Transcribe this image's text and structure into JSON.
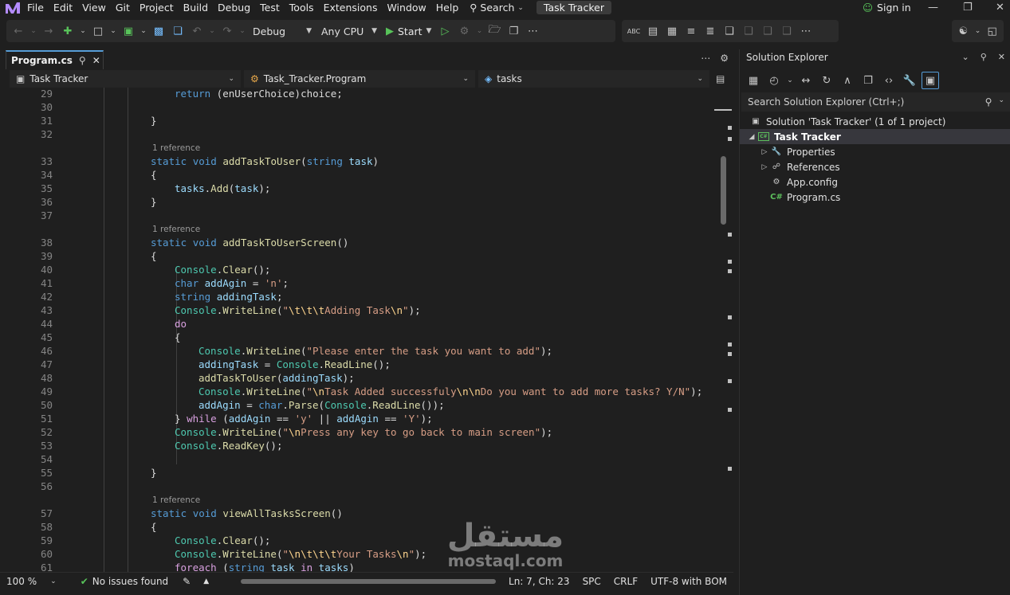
{
  "menu": {
    "items": [
      "File",
      "Edit",
      "View",
      "Git",
      "Project",
      "Build",
      "Debug",
      "Test",
      "Tools",
      "Extensions",
      "Window",
      "Help"
    ],
    "search_label": "Search",
    "window_title": "Task Tracker",
    "sign_in": "Sign in"
  },
  "toolbar": {
    "config": "Debug",
    "platform": "Any CPU",
    "start": "Start"
  },
  "editor": {
    "tab_label": "Program.cs",
    "nav_project": "Task Tracker",
    "nav_class": "Task_Tracker.Program",
    "nav_member": "tasks",
    "codelens": "1 reference",
    "lines": [
      {
        "n": "29",
        "tokens": [
          [
            "kw",
            "return"
          ],
          [
            "pl",
            " ("
          ],
          [
            "pl",
            "enUserChoice"
          ],
          [
            "pl",
            ")"
          ],
          [
            "pl",
            "choice;"
          ]
        ],
        "indent": 1
      },
      {
        "n": "30",
        "tokens": [],
        "indent": 0
      },
      {
        "n": "31",
        "tokens": [
          [
            "pl",
            "}"
          ]
        ],
        "indent": 0
      },
      {
        "n": "32",
        "tokens": [],
        "indent": 0
      },
      {
        "n": "33",
        "lens": true,
        "tokens": [
          [
            "kw",
            "static"
          ],
          [
            "pl",
            " "
          ],
          [
            "kw",
            "void"
          ],
          [
            "pl",
            " "
          ],
          [
            "fn",
            "addTaskToUser"
          ],
          [
            "pl",
            "("
          ],
          [
            "kw",
            "string"
          ],
          [
            "pl",
            " "
          ],
          [
            "var",
            "task"
          ],
          [
            "pl",
            ")"
          ]
        ],
        "indent": 0
      },
      {
        "n": "34",
        "tokens": [
          [
            "pl",
            "{"
          ]
        ],
        "indent": 0
      },
      {
        "n": "35",
        "tokens": [
          [
            "var",
            "tasks"
          ],
          [
            "pl",
            "."
          ],
          [
            "fn",
            "Add"
          ],
          [
            "pl",
            "("
          ],
          [
            "var",
            "task"
          ],
          [
            "pl",
            ");"
          ]
        ],
        "indent": 1
      },
      {
        "n": "36",
        "tokens": [
          [
            "pl",
            "}"
          ]
        ],
        "indent": 0
      },
      {
        "n": "37",
        "tokens": [],
        "indent": 0
      },
      {
        "n": "38",
        "lens": true,
        "tokens": [
          [
            "kw",
            "static"
          ],
          [
            "pl",
            " "
          ],
          [
            "kw",
            "void"
          ],
          [
            "pl",
            " "
          ],
          [
            "fn",
            "addTaskToUserScreen"
          ],
          [
            "pl",
            "()"
          ]
        ],
        "indent": 0
      },
      {
        "n": "39",
        "tokens": [
          [
            "pl",
            "{"
          ]
        ],
        "indent": 0
      },
      {
        "n": "40",
        "tokens": [
          [
            "ty",
            "Console"
          ],
          [
            "pl",
            "."
          ],
          [
            "fn",
            "Clear"
          ],
          [
            "pl",
            "();"
          ]
        ],
        "indent": 1
      },
      {
        "n": "41",
        "tokens": [
          [
            "kw",
            "char"
          ],
          [
            "pl",
            " "
          ],
          [
            "var",
            "addAgin"
          ],
          [
            "pl",
            " = "
          ],
          [
            "str",
            "'n'"
          ],
          [
            "pl",
            ";"
          ]
        ],
        "indent": 1
      },
      {
        "n": "42",
        "tokens": [
          [
            "kw",
            "string"
          ],
          [
            "pl",
            " "
          ],
          [
            "var",
            "addingTask"
          ],
          [
            "pl",
            ";"
          ]
        ],
        "indent": 1
      },
      {
        "n": "43",
        "tokens": [
          [
            "ty",
            "Console"
          ],
          [
            "pl",
            "."
          ],
          [
            "fn",
            "WriteLine"
          ],
          [
            "pl",
            "("
          ],
          [
            "str",
            "\""
          ],
          [
            "esc",
            "\\t\\t\\t"
          ],
          [
            "str",
            "Adding Task"
          ],
          [
            "esc",
            "\\n"
          ],
          [
            "str",
            "\""
          ],
          [
            "pl",
            ");"
          ]
        ],
        "indent": 1
      },
      {
        "n": "44",
        "tokens": [
          [
            "ctl",
            "do"
          ]
        ],
        "indent": 1
      },
      {
        "n": "45",
        "tokens": [
          [
            "pl",
            "{"
          ]
        ],
        "indent": 1
      },
      {
        "n": "46",
        "tokens": [
          [
            "ty",
            "Console"
          ],
          [
            "pl",
            "."
          ],
          [
            "fn",
            "WriteLine"
          ],
          [
            "pl",
            "("
          ],
          [
            "str",
            "\"Please enter the task you want to add\""
          ],
          [
            "pl",
            ");"
          ]
        ],
        "indent": 2
      },
      {
        "n": "47",
        "tokens": [
          [
            "var",
            "addingTask"
          ],
          [
            "pl",
            " = "
          ],
          [
            "ty",
            "Console"
          ],
          [
            "pl",
            "."
          ],
          [
            "fn",
            "ReadLine"
          ],
          [
            "pl",
            "();"
          ]
        ],
        "indent": 2
      },
      {
        "n": "48",
        "tokens": [
          [
            "fn",
            "addTaskToUser"
          ],
          [
            "pl",
            "("
          ],
          [
            "var",
            "addingTask"
          ],
          [
            "pl",
            ");"
          ]
        ],
        "indent": 2
      },
      {
        "n": "49",
        "tokens": [
          [
            "ty",
            "Console"
          ],
          [
            "pl",
            "."
          ],
          [
            "fn",
            "WriteLine"
          ],
          [
            "pl",
            "("
          ],
          [
            "str",
            "\""
          ],
          [
            "esc",
            "\\n"
          ],
          [
            "str",
            "Task Added successfuly"
          ],
          [
            "esc",
            "\\n\\n"
          ],
          [
            "str",
            "Do you want to add more tasks? Y/N\""
          ],
          [
            "pl",
            ");"
          ]
        ],
        "indent": 2
      },
      {
        "n": "50",
        "tokens": [
          [
            "var",
            "addAgin"
          ],
          [
            "pl",
            " = "
          ],
          [
            "kw",
            "char"
          ],
          [
            "pl",
            "."
          ],
          [
            "fn",
            "Parse"
          ],
          [
            "pl",
            "("
          ],
          [
            "ty",
            "Console"
          ],
          [
            "pl",
            "."
          ],
          [
            "fn",
            "ReadLine"
          ],
          [
            "pl",
            "());"
          ]
        ],
        "indent": 2
      },
      {
        "n": "51",
        "tokens": [
          [
            "pl",
            "} "
          ],
          [
            "ctl",
            "while"
          ],
          [
            "pl",
            " ("
          ],
          [
            "var",
            "addAgin"
          ],
          [
            "pl",
            " == "
          ],
          [
            "str",
            "'y'"
          ],
          [
            "pl",
            " || "
          ],
          [
            "var",
            "addAgin"
          ],
          [
            "pl",
            " == "
          ],
          [
            "str",
            "'Y'"
          ],
          [
            "pl",
            ");"
          ]
        ],
        "indent": 1
      },
      {
        "n": "52",
        "tokens": [
          [
            "ty",
            "Console"
          ],
          [
            "pl",
            "."
          ],
          [
            "fn",
            "WriteLine"
          ],
          [
            "pl",
            "("
          ],
          [
            "str",
            "\""
          ],
          [
            "esc",
            "\\n"
          ],
          [
            "str",
            "Press any key to go back to main screen\""
          ],
          [
            "pl",
            ");"
          ]
        ],
        "indent": 1
      },
      {
        "n": "53",
        "tokens": [
          [
            "ty",
            "Console"
          ],
          [
            "pl",
            "."
          ],
          [
            "fn",
            "ReadKey"
          ],
          [
            "pl",
            "();"
          ]
        ],
        "indent": 1
      },
      {
        "n": "54",
        "tokens": [],
        "indent": 0
      },
      {
        "n": "55",
        "tokens": [
          [
            "pl",
            "}"
          ]
        ],
        "indent": 0
      },
      {
        "n": "56",
        "tokens": [],
        "indent": 0
      },
      {
        "n": "57",
        "lens": true,
        "tokens": [
          [
            "kw",
            "static"
          ],
          [
            "pl",
            " "
          ],
          [
            "kw",
            "void"
          ],
          [
            "pl",
            " "
          ],
          [
            "fn",
            "viewAllTasksScreen"
          ],
          [
            "pl",
            "()"
          ]
        ],
        "indent": 0
      },
      {
        "n": "58",
        "tokens": [
          [
            "pl",
            "{"
          ]
        ],
        "indent": 0
      },
      {
        "n": "59",
        "tokens": [
          [
            "ty",
            "Console"
          ],
          [
            "pl",
            "."
          ],
          [
            "fn",
            "Clear"
          ],
          [
            "pl",
            "();"
          ]
        ],
        "indent": 1
      },
      {
        "n": "60",
        "tokens": [
          [
            "ty",
            "Console"
          ],
          [
            "pl",
            "."
          ],
          [
            "fn",
            "WriteLine"
          ],
          [
            "pl",
            "("
          ],
          [
            "str",
            "\""
          ],
          [
            "esc",
            "\\n\\t\\t\\t"
          ],
          [
            "str",
            "Your Tasks"
          ],
          [
            "esc",
            "\\n"
          ],
          [
            "str",
            "\""
          ],
          [
            "pl",
            ");"
          ]
        ],
        "indent": 1
      },
      {
        "n": "61",
        "tokens": [
          [
            "ctl",
            "foreach"
          ],
          [
            "pl",
            " ("
          ],
          [
            "kw",
            "string"
          ],
          [
            "pl",
            " "
          ],
          [
            "var",
            "task"
          ],
          [
            "pl",
            " "
          ],
          [
            "ctl",
            "in"
          ],
          [
            "pl",
            " "
          ],
          [
            "var",
            "tasks"
          ],
          [
            "pl",
            ")"
          ]
        ],
        "indent": 1
      }
    ]
  },
  "status": {
    "zoom": "100 %",
    "issues": "No issues found",
    "position": "Ln: 7, Ch: 23",
    "spacing": "SPC",
    "eol": "CRLF",
    "encoding": "UTF-8 with BOM"
  },
  "solution_explorer": {
    "title": "Solution Explorer",
    "search_placeholder": "Search Solution Explorer (Ctrl+;)",
    "solution": "Solution 'Task Tracker' (1 of 1 project)",
    "project": "Task Tracker",
    "items": [
      "Properties",
      "References",
      "App.config",
      "Program.cs"
    ]
  },
  "watermark": {
    "arabic": "مستقل",
    "latin": "mostaql.com"
  },
  "colors": {
    "accent": "#569cd6",
    "keyword": "#569cd6",
    "type": "#4ec9b0",
    "method": "#dcdcaa",
    "string": "#d69d85",
    "control": "#d8a0df",
    "variable": "#9cdcfe"
  }
}
